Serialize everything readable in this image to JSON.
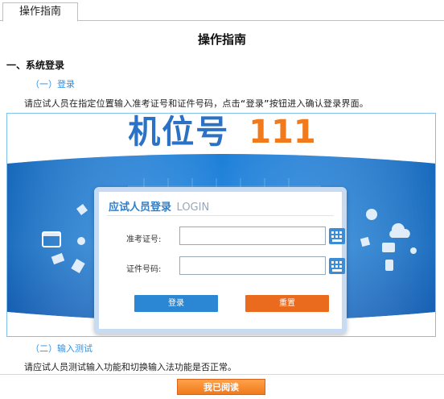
{
  "tab": {
    "label": "操作指南"
  },
  "page": {
    "title": "操作指南"
  },
  "section1": {
    "heading": "一、系统登录",
    "sub": "（一）登录",
    "text": "请应试人员在指定位置输入准考证号和证件号码，点击“登录”按钮进入确认登录界面。"
  },
  "screenshot": {
    "machine_label": "机位号",
    "machine_number": "111",
    "dialog_title": "应试人员登录",
    "dialog_title_en": "LOGIN",
    "ticket_label": "准考证号:",
    "id_label": "证件号码:",
    "ticket_value": "",
    "id_value": "",
    "login_button": "登录",
    "reset_button": "重置",
    "keyboard_icon": "keyboard-icon"
  },
  "section2": {
    "sub": "（二）输入测试",
    "text": "请应试人员测试输入功能和切换输入法功能是否正常。"
  },
  "footer": {
    "read_button": "我已阅读"
  },
  "colors": {
    "accent_blue": "#2b86d3",
    "accent_orange": "#ea6a1e",
    "machine_blue": "#2b72c6",
    "machine_orange": "#f07a1c"
  }
}
